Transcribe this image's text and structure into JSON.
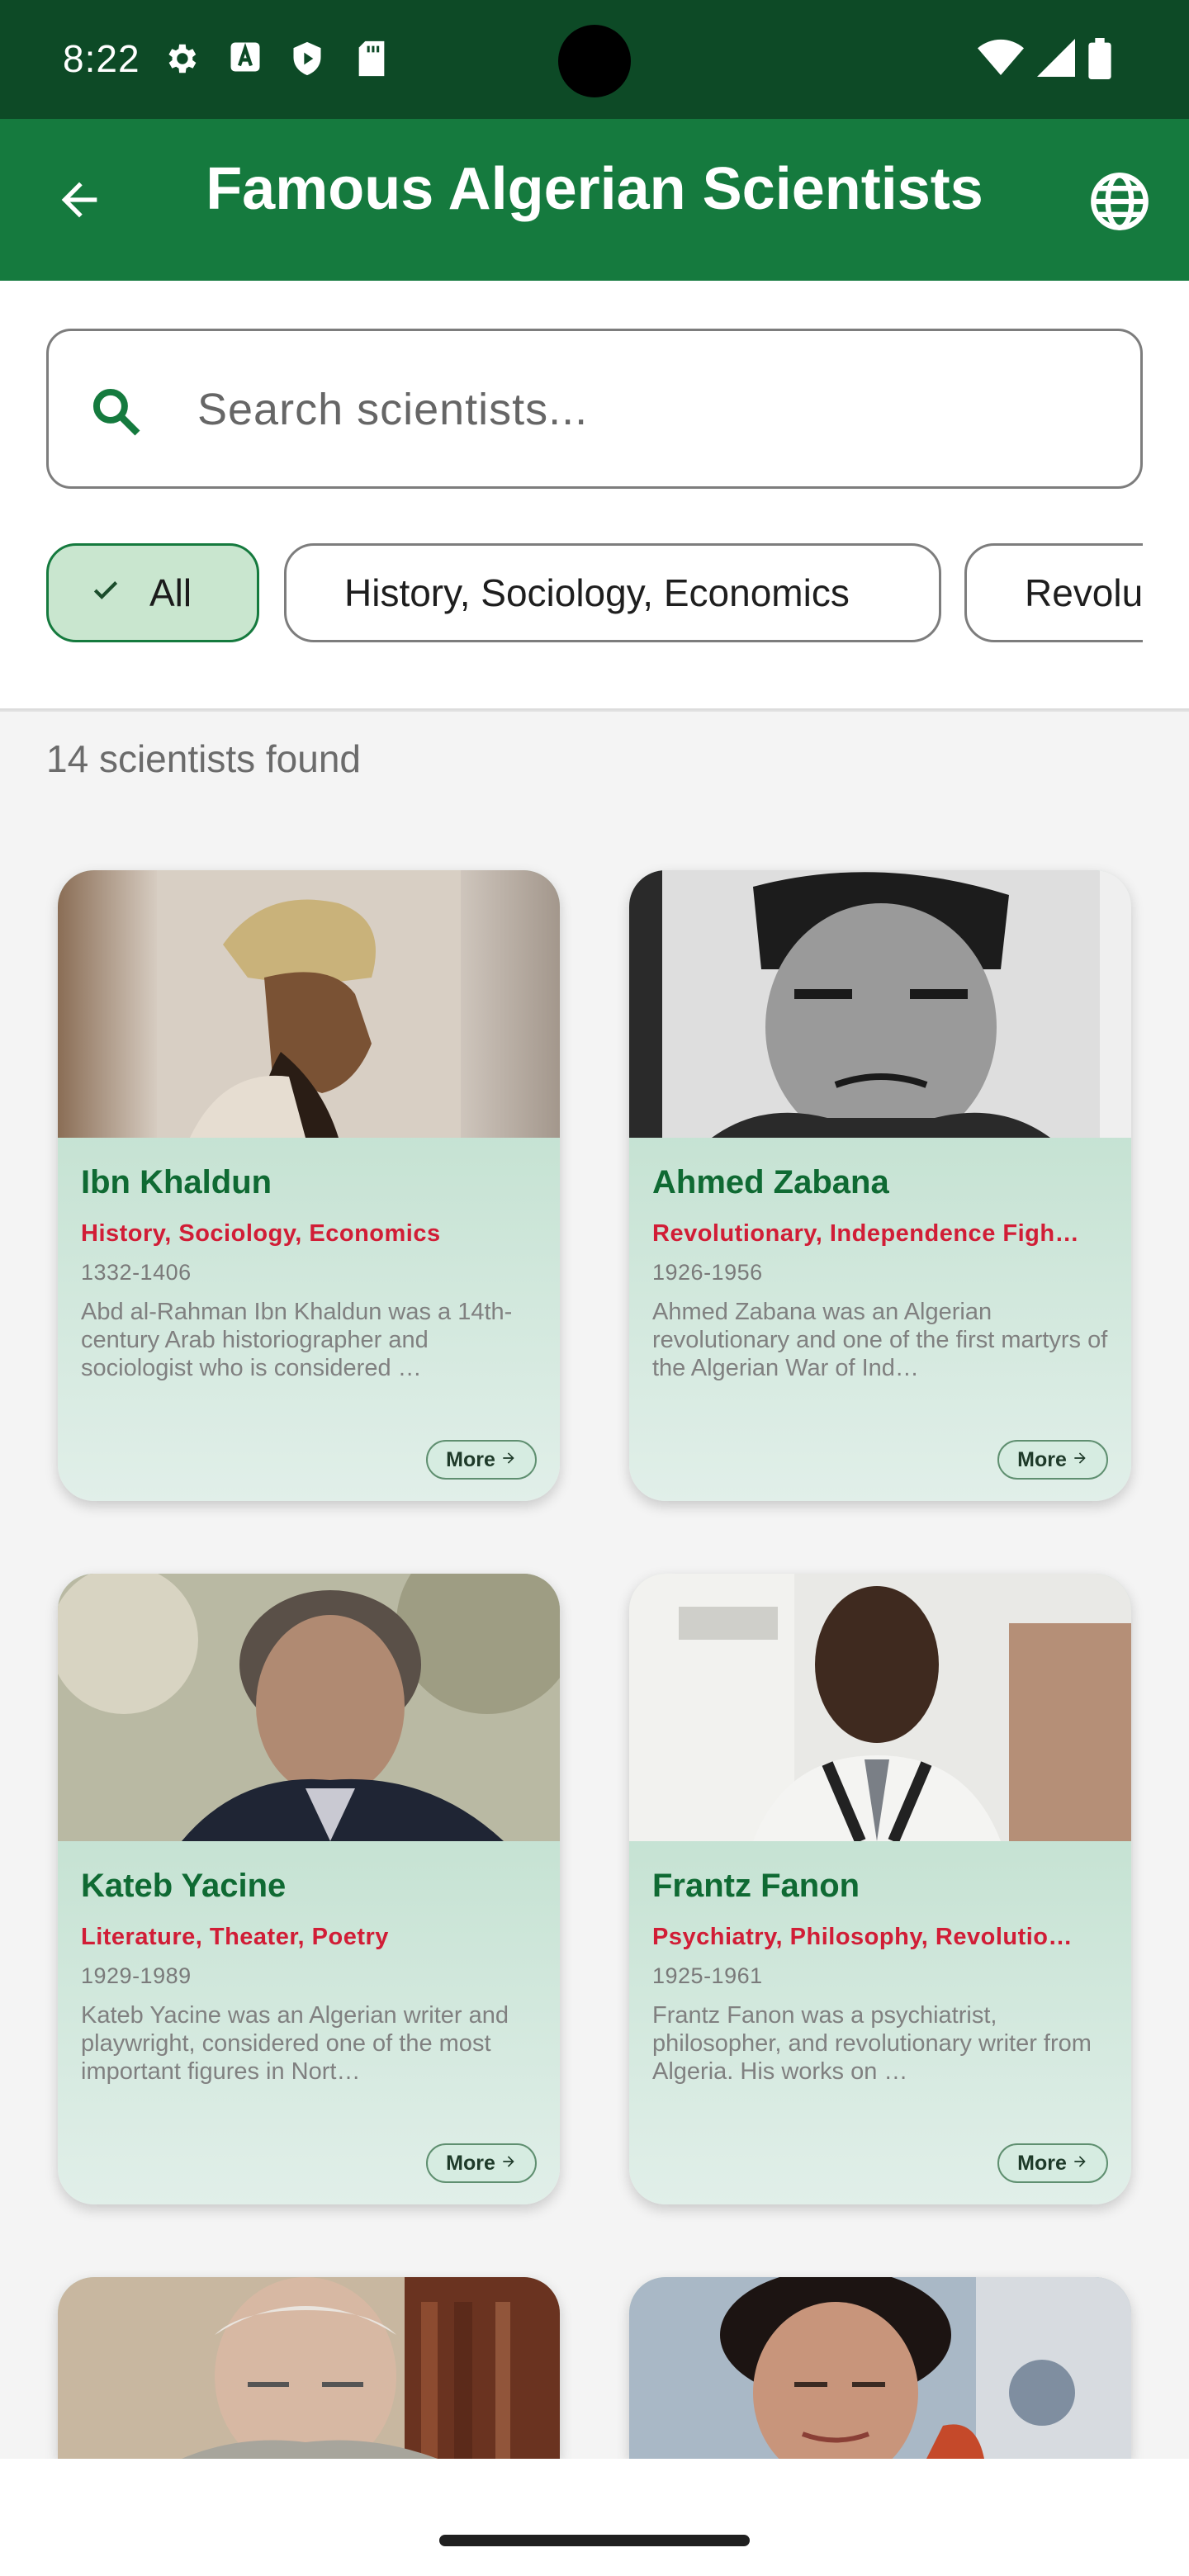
{
  "status_bar": {
    "time": "8:22",
    "left_icons": [
      "settings-icon",
      "a-badge-icon",
      "shield-play-icon",
      "sd-card-icon"
    ],
    "right_icons": [
      "wifi-icon",
      "signal-icon",
      "battery-icon"
    ]
  },
  "app_bar": {
    "title": "Famous Algerian Scientists",
    "back_icon": "arrow-back-icon",
    "language_icon": "globe-icon",
    "background": "#157a3e"
  },
  "search": {
    "placeholder": "Search scientists...",
    "value": ""
  },
  "filters": [
    {
      "label": "All",
      "selected": true
    },
    {
      "label": "History, Sociology, Economics",
      "selected": false
    },
    {
      "label": "Revolu",
      "selected": false
    }
  ],
  "results": {
    "count_text": "14 scientists found"
  },
  "cards": [
    {
      "name": "Ibn Khaldun",
      "field": "History, Sociology, Economics",
      "years": "1332-1406",
      "description": "Abd al-Rahman Ibn Khaldun was a 14th-century Arab historiographer and sociologist who is considered …",
      "more_label": "More"
    },
    {
      "name": "Ahmed Zabana",
      "field": "Revolutionary, Independence Figh…",
      "years": "1926-1956",
      "description": "Ahmed Zabana was an Algerian revolutionary and one of the first martyrs of the Algerian War of Ind…",
      "more_label": "More"
    },
    {
      "name": "Kateb Yacine",
      "field": "Literature, Theater, Poetry",
      "years": "1929-1989",
      "description": "Kateb Yacine was an Algerian writer and playwright, considered one of the most important figures in Nort…",
      "more_label": "More"
    },
    {
      "name": "Frantz Fanon",
      "field": "Psychiatry, Philosophy, Revolutio…",
      "years": "1925-1961",
      "description": "Frantz Fanon was a psychiatrist, philosopher, and revolutionary writer from Algeria. His works on …",
      "more_label": "More"
    },
    {
      "name": "",
      "field": "",
      "years": "",
      "description": "",
      "more_label": ""
    },
    {
      "name": "",
      "field": "",
      "years": "",
      "description": "",
      "more_label": ""
    }
  ],
  "colors": {
    "status_bar": "#0d4a26",
    "app_bar": "#157a3e",
    "name": "#0f6a33",
    "field": "#d11d36",
    "chip_selected": "#c9e6cf"
  }
}
